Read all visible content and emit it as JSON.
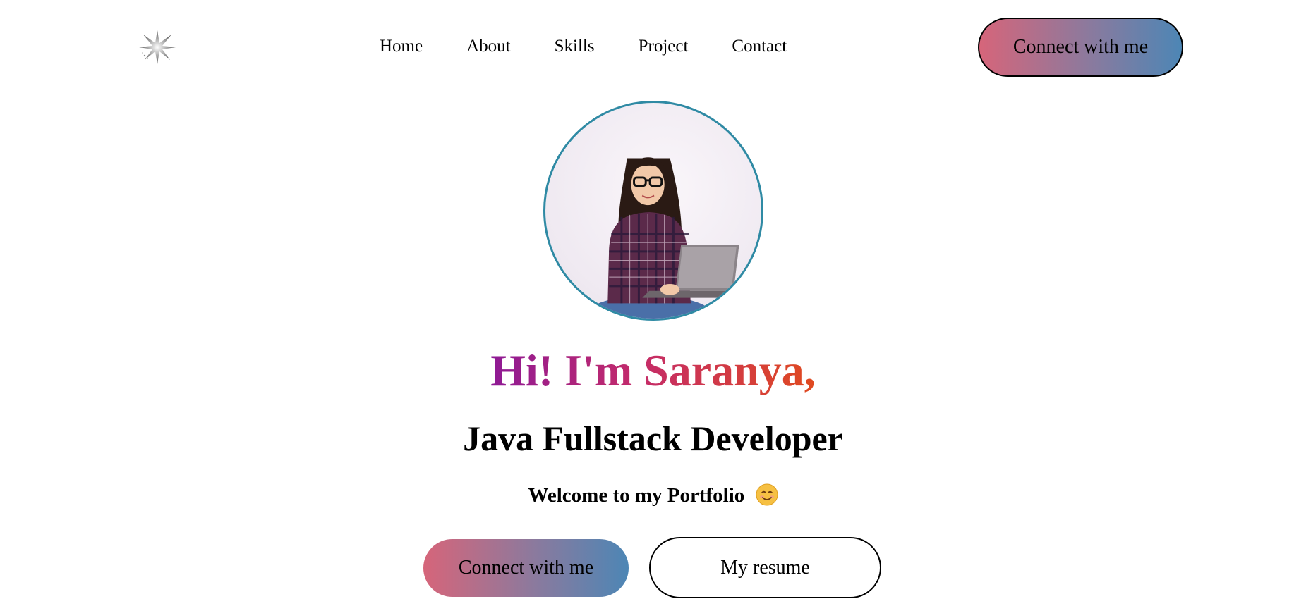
{
  "header": {
    "logo_icon": "sparkle-star-icon",
    "nav": [
      {
        "label": "Home"
      },
      {
        "label": "About"
      },
      {
        "label": "Skills"
      },
      {
        "label": "Project"
      },
      {
        "label": "Contact"
      }
    ],
    "cta_label": "Connect with me"
  },
  "hero": {
    "avatar_icon": "profile-photo",
    "greeting": "Hi! I'm Saranya,",
    "role": "Java Fullstack Developer",
    "welcome": "Welcome to my Portfolio",
    "welcome_emoji": "smiling-face-icon",
    "primary_button": "Connect with me",
    "secondary_button": "My resume"
  },
  "colors": {
    "button_gradient_start": "#d6657a",
    "button_gradient_end": "#4d86b5",
    "avatar_border": "#2f8aa4",
    "greeting_gradient_start": "#8e1a95",
    "greeting_gradient_end": "#e04a1f"
  }
}
